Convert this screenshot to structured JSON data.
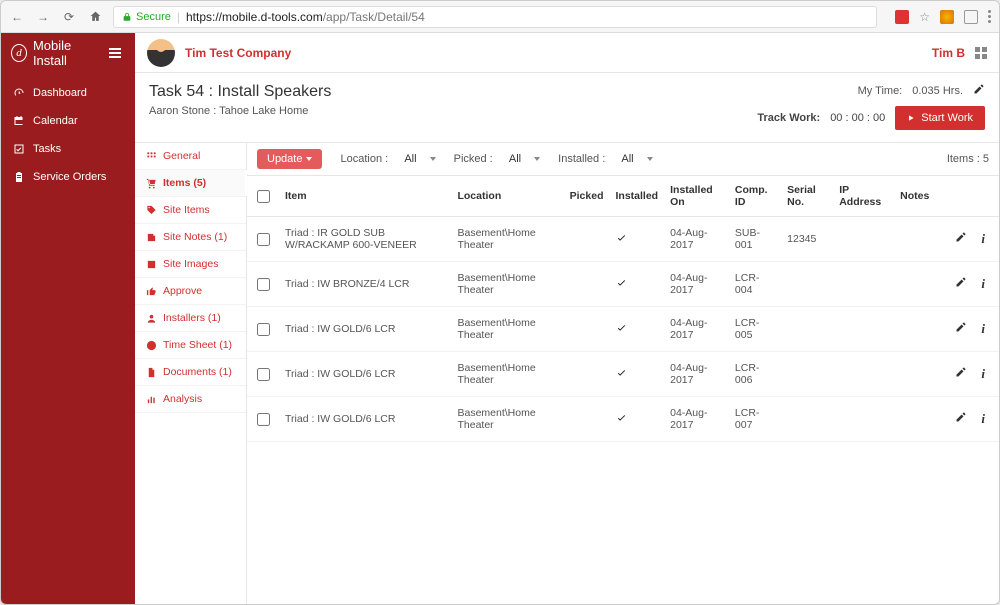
{
  "chrome": {
    "secure_label": "Secure",
    "url_host": "https://mobile.d-tools.com",
    "url_path": "/app/Task/Detail/54"
  },
  "sidebar": {
    "app_name": "Mobile Install",
    "items": [
      {
        "label": "Dashboard"
      },
      {
        "label": "Calendar"
      },
      {
        "label": "Tasks"
      },
      {
        "label": "Service Orders"
      }
    ]
  },
  "topbar": {
    "company": "Tim Test Company",
    "user": "Tim B"
  },
  "page_header": {
    "title": "Task 54 : Install Speakers",
    "subtitle": "Aaron Stone : Tahoe Lake Home",
    "my_time_label": "My Time:",
    "my_time_value": "0.035 Hrs.",
    "track_work_label": "Track Work:",
    "track_work_timer": "00 : 00 : 00",
    "start_work_label": "Start Work"
  },
  "side_panel": {
    "items": [
      {
        "label": "General"
      },
      {
        "label": "Items (5)"
      },
      {
        "label": "Site Items"
      },
      {
        "label": "Site Notes (1)"
      },
      {
        "label": "Site Images"
      },
      {
        "label": "Approve"
      },
      {
        "label": "Installers (1)"
      },
      {
        "label": "Time Sheet (1)"
      },
      {
        "label": "Documents (1)"
      },
      {
        "label": "Analysis"
      }
    ]
  },
  "filters": {
    "update_label": "Update",
    "location_label": "Location :",
    "location_value": "All",
    "picked_label": "Picked :",
    "picked_value": "All",
    "installed_label": "Installed :",
    "installed_value": "All",
    "item_count_label": "Items : 5"
  },
  "table": {
    "headers": {
      "item": "Item",
      "location": "Location",
      "picked": "Picked",
      "installed": "Installed",
      "installed_on": "Installed On",
      "comp_id": "Comp. ID",
      "serial_no": "Serial No.",
      "ip_address": "IP Address",
      "notes": "Notes"
    },
    "rows": [
      {
        "item": "Triad : IR GOLD SUB W/RACKAMP 600-VENEER",
        "location": "Basement\\Home Theater",
        "installed": true,
        "installed_on": "04-Aug-2017",
        "comp_id": "SUB-001",
        "serial_no": "12345",
        "ip": "",
        "notes": ""
      },
      {
        "item": "Triad : IW BRONZE/4 LCR",
        "location": "Basement\\Home Theater",
        "installed": true,
        "installed_on": "04-Aug-2017",
        "comp_id": "LCR-004",
        "serial_no": "",
        "ip": "",
        "notes": ""
      },
      {
        "item": "Triad : IW GOLD/6 LCR",
        "location": "Basement\\Home Theater",
        "installed": true,
        "installed_on": "04-Aug-2017",
        "comp_id": "LCR-005",
        "serial_no": "",
        "ip": "",
        "notes": ""
      },
      {
        "item": "Triad : IW GOLD/6 LCR",
        "location": "Basement\\Home Theater",
        "installed": true,
        "installed_on": "04-Aug-2017",
        "comp_id": "LCR-006",
        "serial_no": "",
        "ip": "",
        "notes": ""
      },
      {
        "item": "Triad : IW GOLD/6 LCR",
        "location": "Basement\\Home Theater",
        "installed": true,
        "installed_on": "04-Aug-2017",
        "comp_id": "LCR-007",
        "serial_no": "",
        "ip": "",
        "notes": ""
      }
    ]
  }
}
